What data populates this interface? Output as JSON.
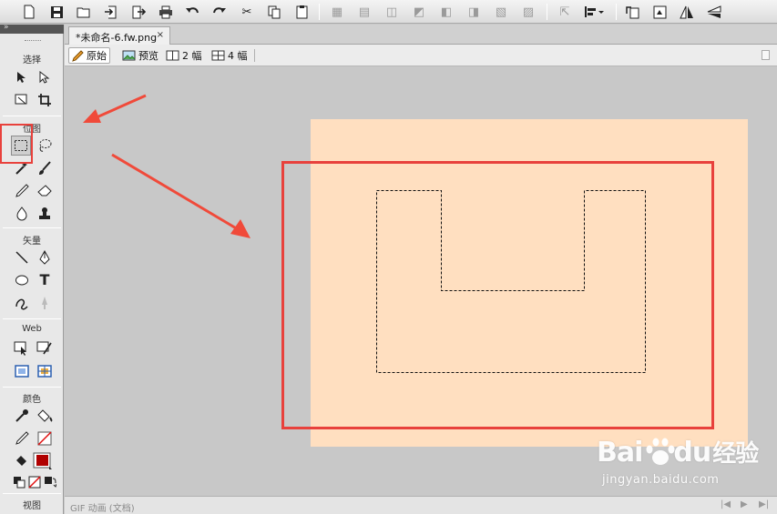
{
  "toolbar": {
    "icons": [
      "new-file-icon",
      "save-icon",
      "open-icon",
      "import-icon",
      "export-icon",
      "print-icon",
      "undo-icon",
      "redo-icon",
      "cut-icon",
      "copy-icon",
      "paste-icon",
      "group-icon",
      "ungroup-icon",
      "join-icon",
      "split-icon",
      "bring-front-icon",
      "send-back-icon",
      "align-icon",
      "distribute-icon",
      "convert-icon",
      "align-menu-icon",
      "rotate-left-icon",
      "rotate-right-icon",
      "flip-horizontal-icon",
      "flip-vertical-icon"
    ]
  },
  "tools_panel": {
    "sections": {
      "select": "选择",
      "bitmap": "位图",
      "vector": "矢量",
      "web": "Web",
      "colors": "颜色",
      "view": "视图"
    },
    "stroke_color": "#ffffff",
    "fill_color": "#b00000"
  },
  "document_tab": {
    "title": "*未命名-6.fw.png",
    "close": "×"
  },
  "view_bar": {
    "original": "原始",
    "preview": "预览",
    "two_up": "2 幅",
    "four_up": "4 幅"
  },
  "canvas": {
    "document_color": "#ffdfc0",
    "highlight_color": "#e8413c"
  },
  "status_bar": {
    "text": "GIF 动画 (文档)"
  },
  "watermark": {
    "brand_left": "Bai",
    "brand_right": "du",
    "brand_cn": "经验",
    "site": "jingyan.baidu.com"
  }
}
